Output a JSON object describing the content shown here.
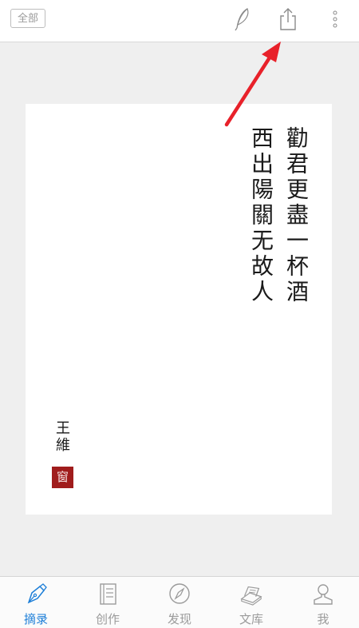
{
  "topbar": {
    "filter_label": "全部",
    "icons": [
      "feather-icon",
      "share-icon",
      "more-vertical-icon"
    ]
  },
  "card": {
    "poem_lines": [
      "勸君更盡一杯酒",
      "西出陽關无故人"
    ],
    "author": "王維",
    "seal_text": "窗"
  },
  "tabs": [
    {
      "label": "摘录",
      "icon": "pen-nib-icon",
      "active": true
    },
    {
      "label": "创作",
      "icon": "notebook-icon",
      "active": false
    },
    {
      "label": "发现",
      "icon": "compass-icon",
      "active": false
    },
    {
      "label": "文库",
      "icon": "books-icon",
      "active": false
    },
    {
      "label": "我",
      "icon": "person-icon",
      "active": false
    }
  ],
  "colors": {
    "accent": "#1e7fd8",
    "seal": "#a01c1c",
    "arrow": "#e8212a",
    "background": "#efefef"
  }
}
